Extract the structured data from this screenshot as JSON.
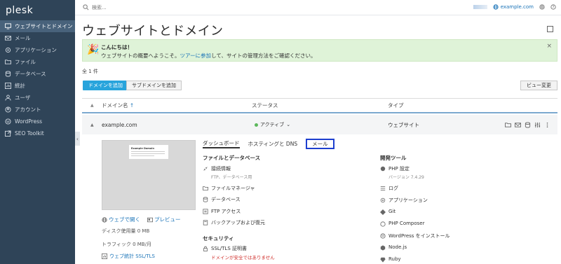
{
  "sidebar": {
    "logo": "plesk",
    "items": [
      {
        "label": "ウェブサイトとドメイン",
        "icon": "monitor-icon",
        "active": true
      },
      {
        "label": "メール",
        "icon": "mail-icon"
      },
      {
        "label": "アプリケーション",
        "icon": "gear-icon"
      },
      {
        "label": "ファイル",
        "icon": "folder-icon"
      },
      {
        "label": "データベース",
        "icon": "database-icon"
      },
      {
        "label": "統計",
        "icon": "chart-icon"
      },
      {
        "label": "ユーザ",
        "icon": "user-icon"
      },
      {
        "label": "アカウント",
        "icon": "account-icon"
      },
      {
        "label": "WordPress",
        "icon": "wordpress-icon"
      },
      {
        "label": "SEO Toolkit",
        "icon": "external-icon"
      }
    ],
    "collapse_glyph": "‹"
  },
  "topbar": {
    "search_placeholder": "検索...",
    "domain": "example.com"
  },
  "page": {
    "title": "ウェブサイトとドメイン"
  },
  "banner": {
    "title": "こんにちは！",
    "text_before": "ウェブサイトの概要へようこそ。",
    "link": "ツアーに参加",
    "text_after": "して、サイトの管理方法をご確認ください。",
    "close": "×"
  },
  "list": {
    "count": "全 1 件",
    "add_domain": "ドメインを追加",
    "add_subdomain": "サブドメインを追加",
    "view_change": "ビュー変更",
    "headers": {
      "name": "ドメイン名",
      "name_arrow": "↑",
      "status": "ステータス",
      "type": "タイプ"
    }
  },
  "row": {
    "domain": "example.com",
    "status": "アクティブ",
    "status_caret": "⌄",
    "type": "ウェブサイト",
    "status_color": "#5cb85c"
  },
  "detail": {
    "thumb_title": "Example Domain",
    "open_web": "ウェブで開く",
    "preview": "プレビュー",
    "disk": "ディスク使用量 0 MB",
    "traffic": "トラフィック 0 MB/月",
    "stats": "ウェブ統計 SSL/TLS",
    "tabs": [
      "ダッシュボード",
      "ホスティングと DNS",
      "メール"
    ],
    "files_db_title": "ファイルとデータベース",
    "files_db": [
      {
        "label": "接続情報",
        "sub": "FTP、データベース用",
        "icon": "connect-icon"
      },
      {
        "label": "ファイルマネージャ",
        "icon": "folder-icon"
      },
      {
        "label": "データベース",
        "icon": "database-icon"
      },
      {
        "label": "FTP アクセス",
        "icon": "ftp-icon"
      },
      {
        "label": "バックアップおよび復元",
        "icon": "backup-icon"
      }
    ],
    "security_title": "セキュリティ",
    "security": [
      {
        "label": "SSL/TLS 証明書",
        "warn": "ドメインが安全ではありません",
        "icon": "lock-icon"
      }
    ],
    "devtools_title": "開発ツール",
    "devtools": [
      {
        "label": "PHP 設定",
        "sub": "バージョン 7.4.29",
        "icon": "php-icon"
      },
      {
        "label": "ログ",
        "icon": "log-icon"
      },
      {
        "label": "アプリケーション",
        "icon": "gear-icon"
      },
      {
        "label": "Git",
        "icon": "git-icon"
      },
      {
        "label": "PHP Composer",
        "icon": "composer-icon"
      },
      {
        "label": "WordPress をインストール",
        "icon": "wordpress-icon"
      },
      {
        "label": "Node.js",
        "icon": "nodejs-icon"
      },
      {
        "label": "Ruby",
        "icon": "ruby-icon"
      }
    ]
  }
}
